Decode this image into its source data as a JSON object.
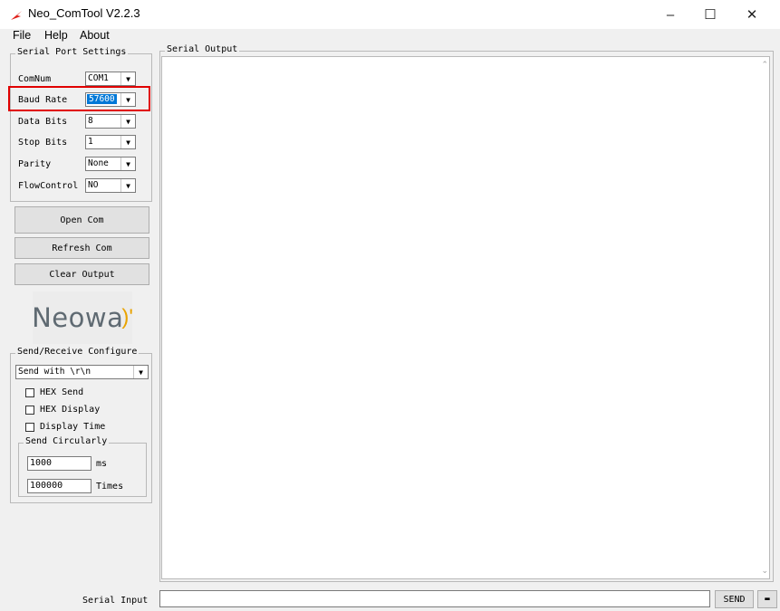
{
  "window": {
    "title": "Neo_ComTool V2.2.3",
    "controls": {
      "minimize": "–",
      "maximize": "☐",
      "close": "✕"
    }
  },
  "menu": [
    "File",
    "Help",
    "About"
  ],
  "serial_port_settings": {
    "title": "Serial Port Settings",
    "rows": [
      {
        "label": "ComNum",
        "value": "COM1"
      },
      {
        "label": "Baud Rate",
        "value": "57600"
      },
      {
        "label": "Data Bits",
        "value": "8"
      },
      {
        "label": "Stop Bits",
        "value": "1"
      },
      {
        "label": "Parity",
        "value": "None"
      },
      {
        "label": "FlowControl",
        "value": "NO"
      }
    ]
  },
  "buttons": {
    "open_com": "Open Com",
    "refresh_com": "Refresh Com",
    "clear_output": "Clear Output"
  },
  "logo": {
    "text": "Neowa",
    "accent": ")'"
  },
  "send_receive": {
    "title": "Send/Receive Configure",
    "mode": "Send with \\r\\n",
    "checkboxes": [
      {
        "label": "HEX Send",
        "checked": false
      },
      {
        "label": "HEX Display",
        "checked": false
      },
      {
        "label": "Display Time",
        "checked": false
      }
    ],
    "send_circularly": {
      "title": "Send Circularly",
      "interval_value": "1000",
      "interval_unit": "ms",
      "times_value": "100000",
      "times_unit": "Times"
    }
  },
  "serial_output": {
    "title": "Serial Output"
  },
  "serial_input": {
    "label": "Serial Input",
    "value": "",
    "send_button": "SEND",
    "extra_button": "▬"
  },
  "colors": {
    "highlight": "#e00000",
    "selection": "#0078d7",
    "app_icon": "#e0201b"
  }
}
